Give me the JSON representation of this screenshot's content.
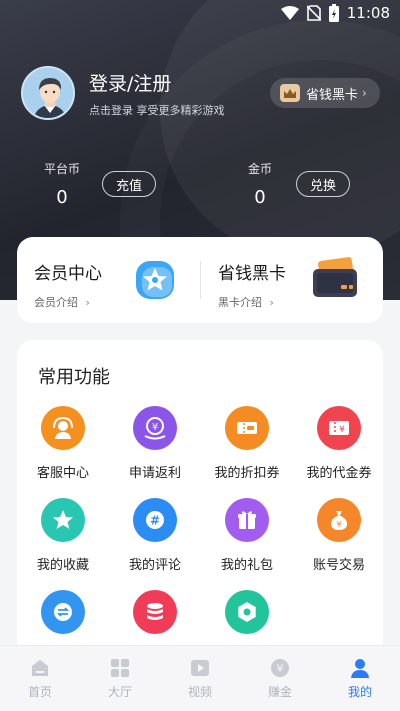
{
  "status_bar": {
    "time": "11:08"
  },
  "profile": {
    "title": "登录/注册",
    "subtitle": "点击登录  享受更多精彩游戏"
  },
  "vip_pill": {
    "label": "省钱黑卡"
  },
  "coins": {
    "platform": {
      "label": "平台币",
      "value": "0",
      "button": "充值"
    },
    "gold": {
      "label": "金币",
      "value": "0",
      "button": "兑换"
    }
  },
  "member": {
    "center": {
      "title": "会员中心",
      "sub": "会员介绍"
    },
    "black_card": {
      "title": "省钱黑卡",
      "sub": "黑卡介绍"
    }
  },
  "functions": {
    "title": "常用功能",
    "items": [
      {
        "label": "客服中心",
        "icon": "headset-icon",
        "color": "#f5901f"
      },
      {
        "label": "申请返利",
        "icon": "rebate-icon",
        "color": "#8a55e8"
      },
      {
        "label": "我的折扣券",
        "icon": "ticket-icon",
        "color": "#f58c23"
      },
      {
        "label": "我的代金券",
        "icon": "voucher-icon",
        "color": "#f0444f"
      },
      {
        "label": "我的收藏",
        "icon": "star-icon",
        "color": "#29c6b1"
      },
      {
        "label": "我的评论",
        "icon": "comment-icon",
        "color": "#2b8cf3"
      },
      {
        "label": "我的礼包",
        "icon": "gift-icon",
        "color": "#a35cf0"
      },
      {
        "label": "账号交易",
        "icon": "moneybag-icon",
        "color": "#f5872a"
      },
      {
        "label": "",
        "icon": "exchange-icon",
        "color": "#3296f0"
      },
      {
        "label": "",
        "icon": "coins-stack-icon",
        "color": "#f03c56"
      },
      {
        "label": "",
        "icon": "settings-icon",
        "color": "#22c49b"
      }
    ]
  },
  "nav": {
    "items": [
      {
        "label": "首页",
        "icon": "home-icon",
        "active": false
      },
      {
        "label": "大厅",
        "icon": "grid-icon",
        "active": false
      },
      {
        "label": "视频",
        "icon": "video-icon",
        "active": false
      },
      {
        "label": "赚金",
        "icon": "yen-coin-icon",
        "active": false
      },
      {
        "label": "我的",
        "icon": "user-icon",
        "active": true
      }
    ]
  }
}
